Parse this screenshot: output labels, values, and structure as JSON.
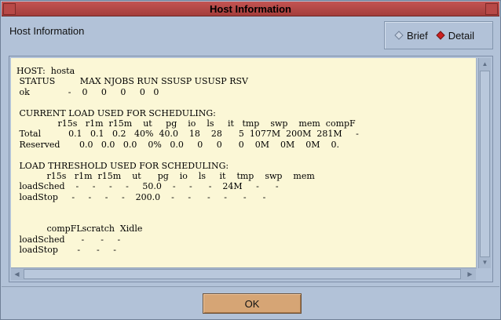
{
  "window": {
    "title": "Host Information"
  },
  "header": {
    "label": "Host Information"
  },
  "view_mode": {
    "options": [
      "Brief",
      "Detail"
    ],
    "selected": "Detail"
  },
  "report": {
    "lines": [
      "HOST:  hosta",
      " STATUS         MAX NJOBS RUN SSUSP USUSP RSV",
      " ok              -    0     0     0     0   0",
      "",
      " CURRENT LOAD USED FOR SCHEDULING:",
      "               r15s   r1m  r15m    ut     pg    io    ls     it   tmp    swp    mem  compF",
      " Total          0.1   0.1   0.2   40%  40.0    18    28      5  1077M  200M  281M     -",
      " Reserved       0.0   0.0   0.0    0%   0.0     0     0      0    0M    0M    0M    0.",
      "",
      " LOAD THRESHOLD USED FOR SCHEDULING:",
      "           r15s   r1m  r15m    ut      pg    io    ls     it    tmp    swp    mem",
      " loadSched    -     -     -     -     50.0    -     -      -    24M     -      -",
      " loadStop     -     -     -     -    200.0    -     -      -     -      -      -",
      "",
      "",
      "           compFLscratch  Xidle",
      " loadSched      -      -     -",
      " loadStop       -      -     -"
    ]
  },
  "actions": {
    "ok_label": "OK"
  },
  "colors": {
    "titlebar": "#b34a48",
    "window_bg": "#b2c2d8",
    "text_bg": "#fbf7d6",
    "ok_button": "#d6a575",
    "selected_radio": "#cc2020"
  }
}
